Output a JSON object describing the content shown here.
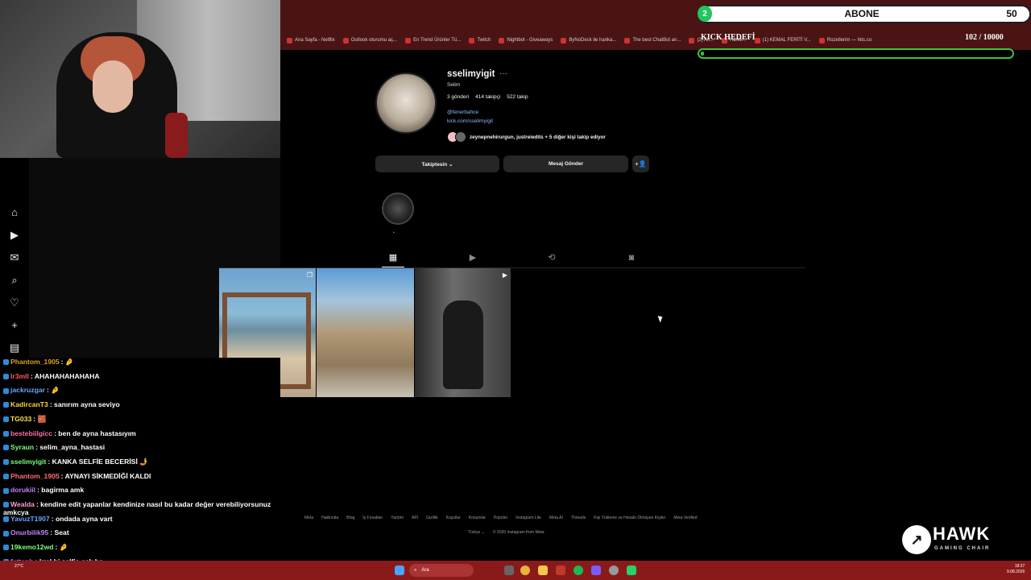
{
  "bookmarks": [
    "Ana Sayfa - Netflix",
    "Outlook oturumu aç...",
    "En Trend Ürünler Tü...",
    "Twitch",
    "Nightbot - Giveaways",
    "ByNoDeck ile harika...",
    "The best ChatBot an...",
    "(2) All...",
    "Harek...",
    "(1) KEMAL FERİTİ V...",
    "Rozetlerim — hits.co"
  ],
  "sidebar_icons": [
    "home-icon",
    "reels-icon",
    "messages-icon",
    "search-icon",
    "heart-icon",
    "plus-icon",
    "dashboard-icon"
  ],
  "profile": {
    "username": "sselimyigit",
    "more": "···",
    "full_name": "Selim",
    "posts": "3 gönderi",
    "followers": "414 takipçi",
    "following": "522 takip",
    "bio_tag": "@fenerbahce",
    "bio_link": "kick.com/sselimyigit",
    "followed_by": "zeynepnehirurgun, justreiedits + 5 diğer kişi takip ediyor",
    "btn_following": "Takiptesin ⌄",
    "btn_message": "Mesaj Gönder",
    "btn_add": "+👤"
  },
  "tabs": [
    {
      "name": "posts-tab-icon",
      "glyph": "▦"
    },
    {
      "name": "reels-tab-icon",
      "glyph": "▶"
    },
    {
      "name": "reposts-tab-icon",
      "glyph": "⟲"
    },
    {
      "name": "tagged-tab-icon",
      "glyph": "◙"
    }
  ],
  "footer": {
    "links": [
      "Meta",
      "Hakkında",
      "Blog",
      "İş Fırsatları",
      "Yardım",
      "API",
      "Gizlilik",
      "Koşullar",
      "Konumlar",
      "Popüler",
      "Instagram Lite",
      "Meta AI",
      "Threads",
      "Kişi Yükleme ve Hesabı Olmayan Kişiler",
      "Meta Verified"
    ],
    "lang": "Türkçe ⌄",
    "copyright": "© 2026 Instagram from Meta"
  },
  "overlay": {
    "sub_count_circle": "2",
    "sub_label": "ABONE",
    "sub_number": "50",
    "kick_title": "KICK HEDEFİ",
    "kick_progress": "102 / 10000",
    "kick_fill_fraction": 0.0102,
    "accent_green": "#3fbf3f"
  },
  "chat": [
    {
      "user": "Phantom_1905",
      "msg": ": 🤌",
      "color": "#e0a020"
    },
    {
      "user": "lr3mll",
      "msg": ": AHAHAHAHAHAHA",
      "color": "#ff5a5a"
    },
    {
      "user": "jackruzgar",
      "msg": ": 🤌",
      "color": "#6aa6ff"
    },
    {
      "user": "KadircanT3",
      "msg": ": sanırım ayna seviyo",
      "color": "#ffd23a"
    },
    {
      "user": "TG033",
      "msg": ": 🧱",
      "color": "#ffe04a"
    },
    {
      "user": "bestebiilgicc",
      "msg": ": ben de ayna hastasıyım",
      "color": "#ff6fa8"
    },
    {
      "user": "Syraun",
      "msg": ": selim_ayna_hastasi",
      "color": "#7dff7d"
    },
    {
      "user": "sselimyigit",
      "msg": ": KANKA SELFİE BECERİSİ 🤳",
      "color": "#7dff7d"
    },
    {
      "user": "Phantom_1905",
      "msg": ": AYNAYI SİKMEDİĞİ KALDI",
      "color": "#ff6f6f"
    },
    {
      "user": "dorukiil",
      "msg": ": bagirma amk",
      "color": "#c084fc"
    },
    {
      "user": "Wealda",
      "msg": ": kendine edit yapanlar kendinize nasıl bu kadar değer verebiliyorsunuz amkcya",
      "color": "#ff9bd2"
    },
    {
      "user": "YavuzT1907",
      "msg": ": ondada ayna vart",
      "color": "#6aa6ff"
    },
    {
      "user": "Onurbilik95",
      "msg": ": Seat",
      "color": "#c084fc"
    },
    {
      "user": "19kemo12wd",
      "msg": ": 🤌",
      "color": "#7dff7d"
    },
    {
      "user": "fettaph",
      "msg": ": kral bi selfie çek be",
      "color": "#c084fc"
    }
  ],
  "hawk": {
    "word": "HAWK",
    "sub": "GAMING CHAIR"
  },
  "taskbar": {
    "search": "Ara",
    "time": "18:37",
    "date": "9.08.2026",
    "weather": "27°C"
  }
}
